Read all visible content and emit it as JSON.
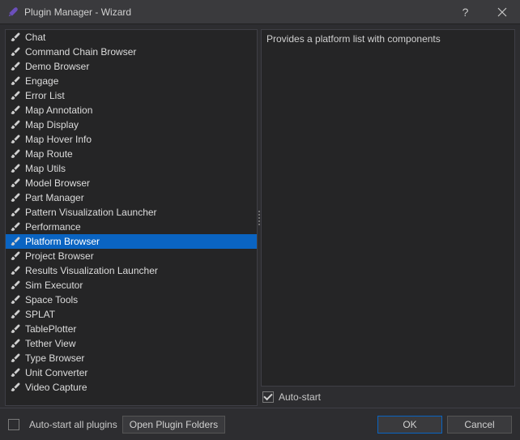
{
  "window": {
    "title": "Plugin Manager - Wizard"
  },
  "plugins": [
    {
      "name": "Chat"
    },
    {
      "name": "Command Chain Browser"
    },
    {
      "name": "Demo Browser"
    },
    {
      "name": "Engage"
    },
    {
      "name": "Error List"
    },
    {
      "name": "Map Annotation"
    },
    {
      "name": "Map Display"
    },
    {
      "name": "Map Hover Info"
    },
    {
      "name": "Map Route"
    },
    {
      "name": "Map Utils"
    },
    {
      "name": "Model Browser"
    },
    {
      "name": "Part Manager"
    },
    {
      "name": "Pattern Visualization Launcher"
    },
    {
      "name": "Performance"
    },
    {
      "name": "Platform Browser",
      "selected": true
    },
    {
      "name": "Project Browser"
    },
    {
      "name": "Results Visualization Launcher"
    },
    {
      "name": "Sim Executor"
    },
    {
      "name": "Space Tools"
    },
    {
      "name": "SPLAT"
    },
    {
      "name": "TablePlotter"
    },
    {
      "name": "Tether View"
    },
    {
      "name": "Type Browser"
    },
    {
      "name": "Unit Converter"
    },
    {
      "name": "Video Capture"
    }
  ],
  "description": "Provides a platform list with components",
  "autostart": {
    "label": "Auto-start",
    "checked": true
  },
  "footer": {
    "autostart_all": {
      "label": "Auto-start all plugins",
      "checked": false
    },
    "open_folders": "Open Plugin Folders",
    "ok": "OK",
    "cancel": "Cancel"
  },
  "colors": {
    "selection": "#0a64c2",
    "panel": "#252526",
    "chrome": "#2d2d30"
  }
}
